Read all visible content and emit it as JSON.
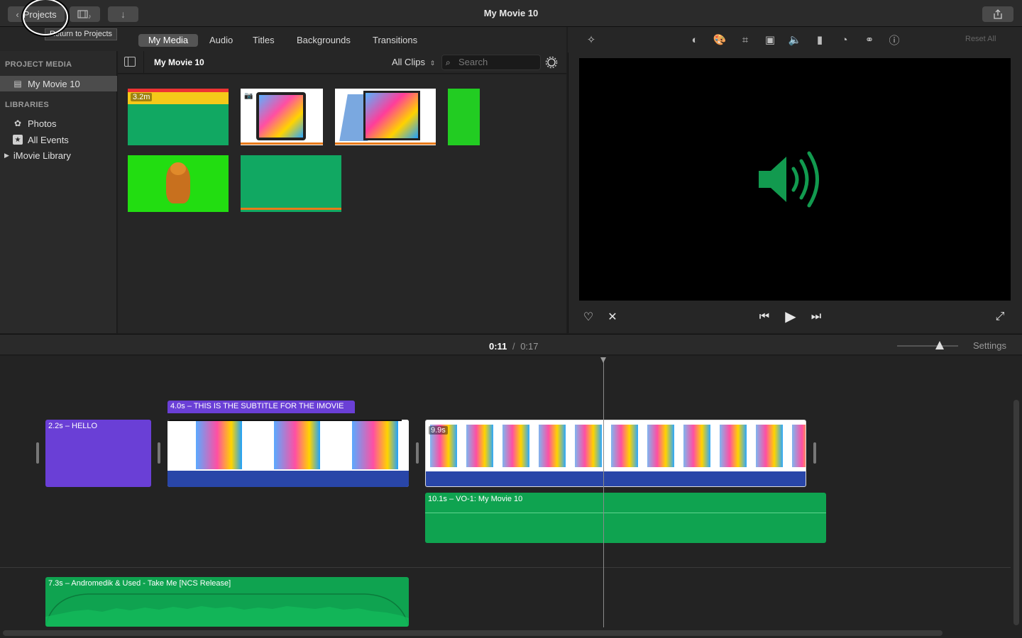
{
  "window": {
    "title": "My Movie 10"
  },
  "toolbar": {
    "projects_label": "Projects",
    "projects_tooltip": "Return to Projects"
  },
  "media_tabs": [
    "My Media",
    "Audio",
    "Titles",
    "Backgrounds",
    "Transitions"
  ],
  "sidebar": {
    "project_media_header": "PROJECT MEDIA",
    "project_item": "My Movie 10",
    "libraries_header": "LIBRARIES",
    "library_items": [
      "Photos",
      "All Events",
      "iMovie Library"
    ]
  },
  "browser": {
    "title": "My Movie 10",
    "filter": "All Clips",
    "search_placeholder": "Search",
    "first_thumb_duration": "3.2m"
  },
  "viewer": {
    "reset_label": "Reset All",
    "icons": [
      "magic-wand-icon",
      "color-balance-icon",
      "color-correction-icon",
      "crop-icon",
      "stabilization-icon",
      "volume-icon",
      "noise-reduction-icon",
      "speed-icon",
      "clip-filter-icon",
      "info-icon"
    ]
  },
  "timeline": {
    "current_time": "0:11",
    "separator": "/",
    "total_time": "0:17",
    "settings_label": "Settings",
    "zoom_level": 0.7,
    "clips": {
      "hello_title": "2.2s – HELLO",
      "subtitle_title": "4.0s – THIS IS THE SUBTITLE FOR THE IMOVIE",
      "video_clip_duration": "9.9s",
      "voiceover": "10.1s – VO-1: My Movie 10",
      "music": "7.3s – Andromedik & Used - Take Me [NCS Release]"
    }
  },
  "colors": {
    "title_purple": "#6a3fd6",
    "audio_green": "#0fa350",
    "video_audio_blue": "#2946a8",
    "green_screen": "#22cc22"
  }
}
